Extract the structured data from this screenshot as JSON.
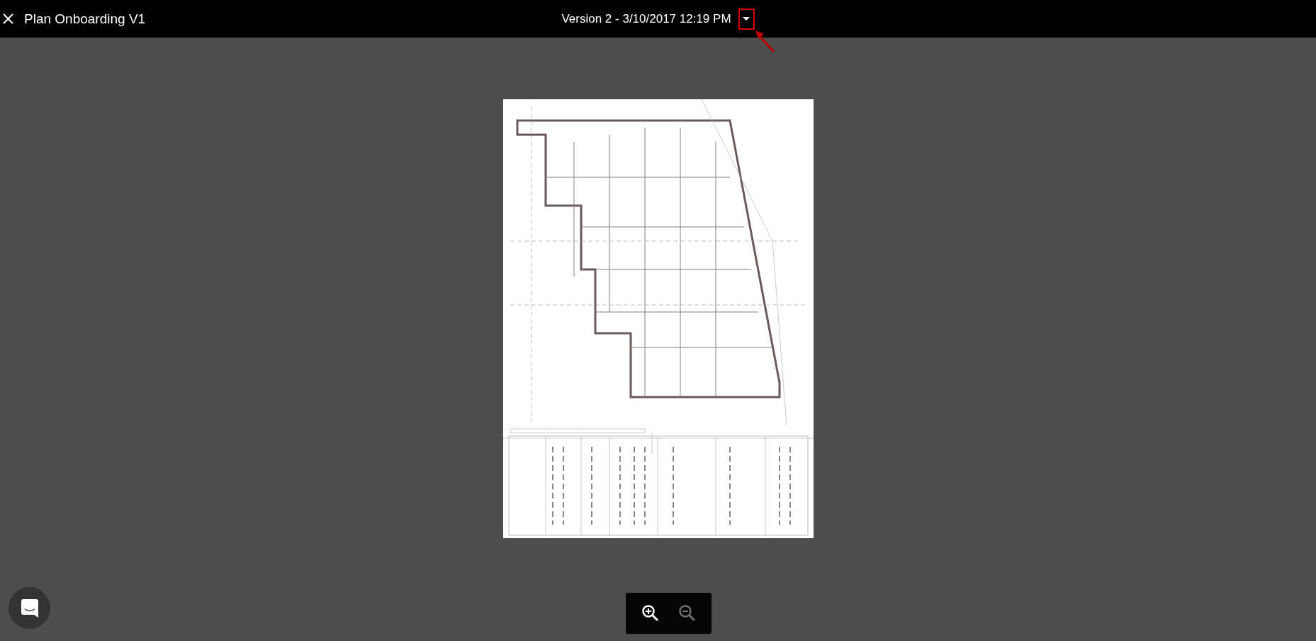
{
  "header": {
    "title": "Plan Onboarding V1",
    "version": "Version 2 - 3/10/2017 12:19 PM"
  },
  "zoom_controls": [
    {
      "kind": "zoom_in",
      "disabled": false
    },
    {
      "kind": "zoom_out",
      "disabled": true
    }
  ]
}
